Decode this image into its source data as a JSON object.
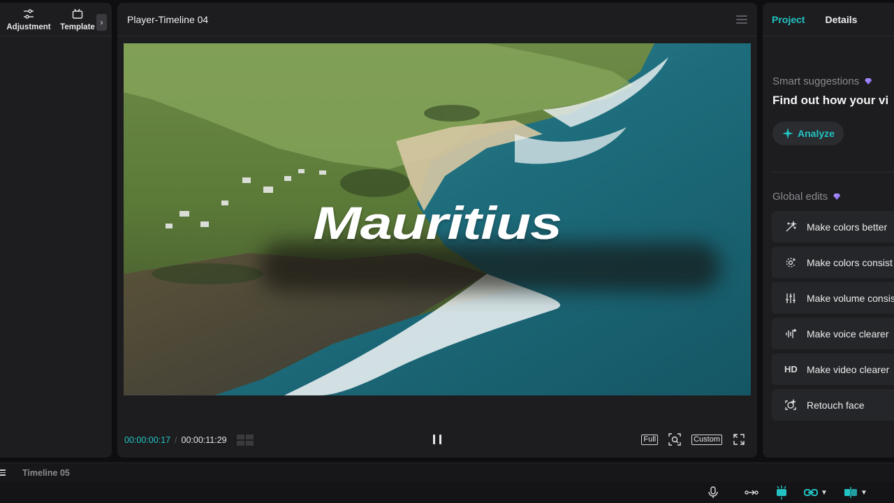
{
  "left_panel": {
    "tabs": [
      {
        "label": "Adjustment",
        "icon": "sliders-icon"
      },
      {
        "label": "Template",
        "icon": "template-icon"
      }
    ],
    "expand_icon": "chevron-right-icon"
  },
  "player": {
    "title": "Player-Timeline 04",
    "video_overlay_text": "Mauritius",
    "current_time": "00:00:00:17",
    "separator": "/",
    "duration": "00:00:11:29",
    "full_label": "Full",
    "custom_label": "Custom"
  },
  "right_panel": {
    "tabs": [
      {
        "label": "Project",
        "active": true
      },
      {
        "label": "Details",
        "active": false
      }
    ],
    "smart_suggestions_title": "Smart suggestions",
    "smart_suggestions_text": "Find out how your vi",
    "analyze_label": "Analyze",
    "global_edits_title": "Global edits",
    "edits": [
      {
        "label": "Make colors better",
        "icon": "magic-wand-icon"
      },
      {
        "label": "Make colors consist",
        "icon": "color-match-icon"
      },
      {
        "label": "Make volume consis",
        "icon": "volume-sliders-icon"
      },
      {
        "label": "Make voice clearer",
        "icon": "voice-wave-icon"
      },
      {
        "label": "Make video clearer",
        "icon": "hd-icon",
        "icon_text": "HD"
      },
      {
        "label": "Retouch face",
        "icon": "face-retouch-icon"
      }
    ]
  },
  "timeline": {
    "label": "Timeline 05"
  },
  "colors": {
    "accent": "#23c3c3",
    "panel_bg": "#1d1d20",
    "app_bg": "#0e0e10"
  }
}
